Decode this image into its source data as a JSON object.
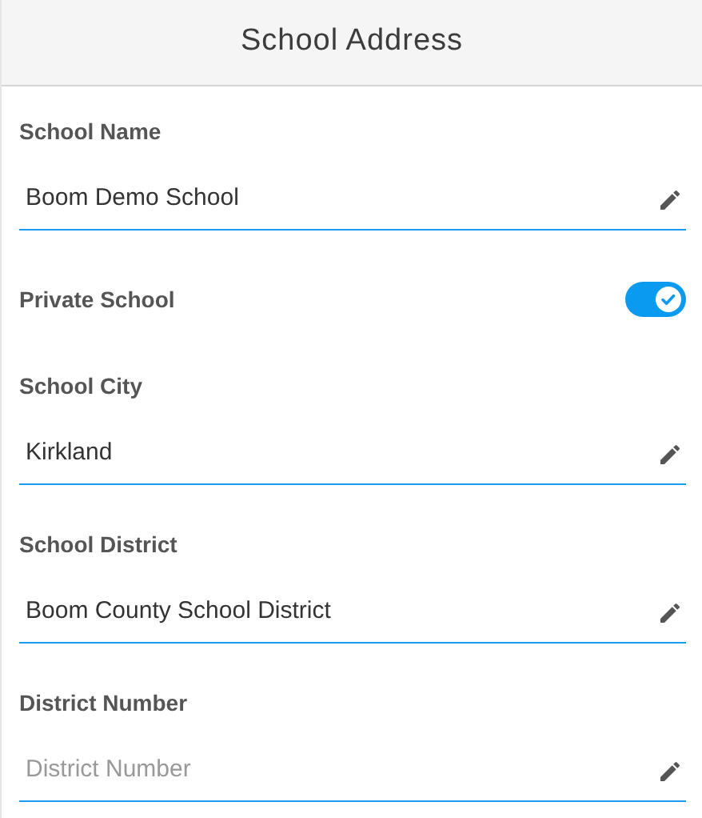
{
  "header": {
    "title": "School Address"
  },
  "fields": [
    {
      "kind": "text",
      "label": "School Name",
      "value": "Boom Demo School"
    },
    {
      "kind": "toggle",
      "label": "Private School",
      "on": true
    },
    {
      "kind": "text",
      "label": "School City",
      "value": "Kirkland"
    },
    {
      "kind": "text",
      "label": "School District",
      "value": "Boom County School District"
    },
    {
      "kind": "text",
      "label": "District Number",
      "placeholder": "District Number"
    }
  ]
}
